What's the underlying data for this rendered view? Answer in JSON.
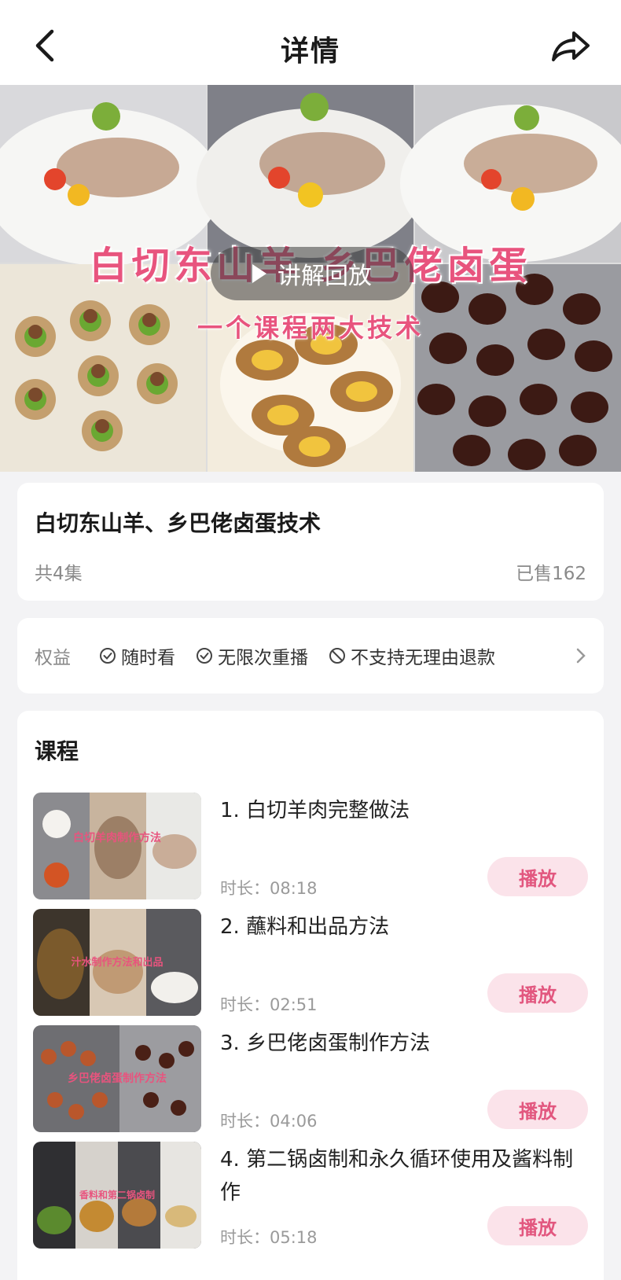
{
  "topbar": {
    "title": "详情",
    "back_icon": "chevron-left-icon",
    "share_icon": "share-icon"
  },
  "banner": {
    "overlay_title": "白切东山羊  乡巴佬卤蛋",
    "overlay_sub": "一个课程两大技术",
    "replay_label": "讲解回放"
  },
  "info": {
    "name": "白切东山羊、乡巴佬卤蛋技术",
    "count": "共4集",
    "sold": "已售162"
  },
  "rights": {
    "label": "权益",
    "items": [
      {
        "icon": "check-circle-icon",
        "text": "随时看"
      },
      {
        "icon": "check-circle-icon",
        "text": "无限次重播"
      },
      {
        "icon": "ban-icon",
        "text": "不支持无理由退款"
      }
    ]
  },
  "course": {
    "heading": "课程",
    "lessons": [
      {
        "title": "1. 白切羊肉完整做法",
        "duration": "时长：08:18",
        "play": "播放",
        "thumb_caption": "白切羊肉制作方法"
      },
      {
        "title": "2. 蘸料和出品方法",
        "duration": "时长：02:51",
        "play": "播放",
        "thumb_caption": "汁水制作方法和出品"
      },
      {
        "title": "3. 乡巴佬卤蛋制作方法",
        "duration": "时长：04:06",
        "play": "播放",
        "thumb_caption": "乡巴佬卤蛋制作方法"
      },
      {
        "title": "4. 第二锅卤制和永久循环使用及酱料制作",
        "duration": "时长：05:18",
        "play": "播放",
        "thumb_caption": "香料和第二锅卤制"
      }
    ]
  },
  "colors": {
    "accent": "#e2577f",
    "accent_bg": "#fbe3ea",
    "page_bg": "#f3f3f5"
  }
}
